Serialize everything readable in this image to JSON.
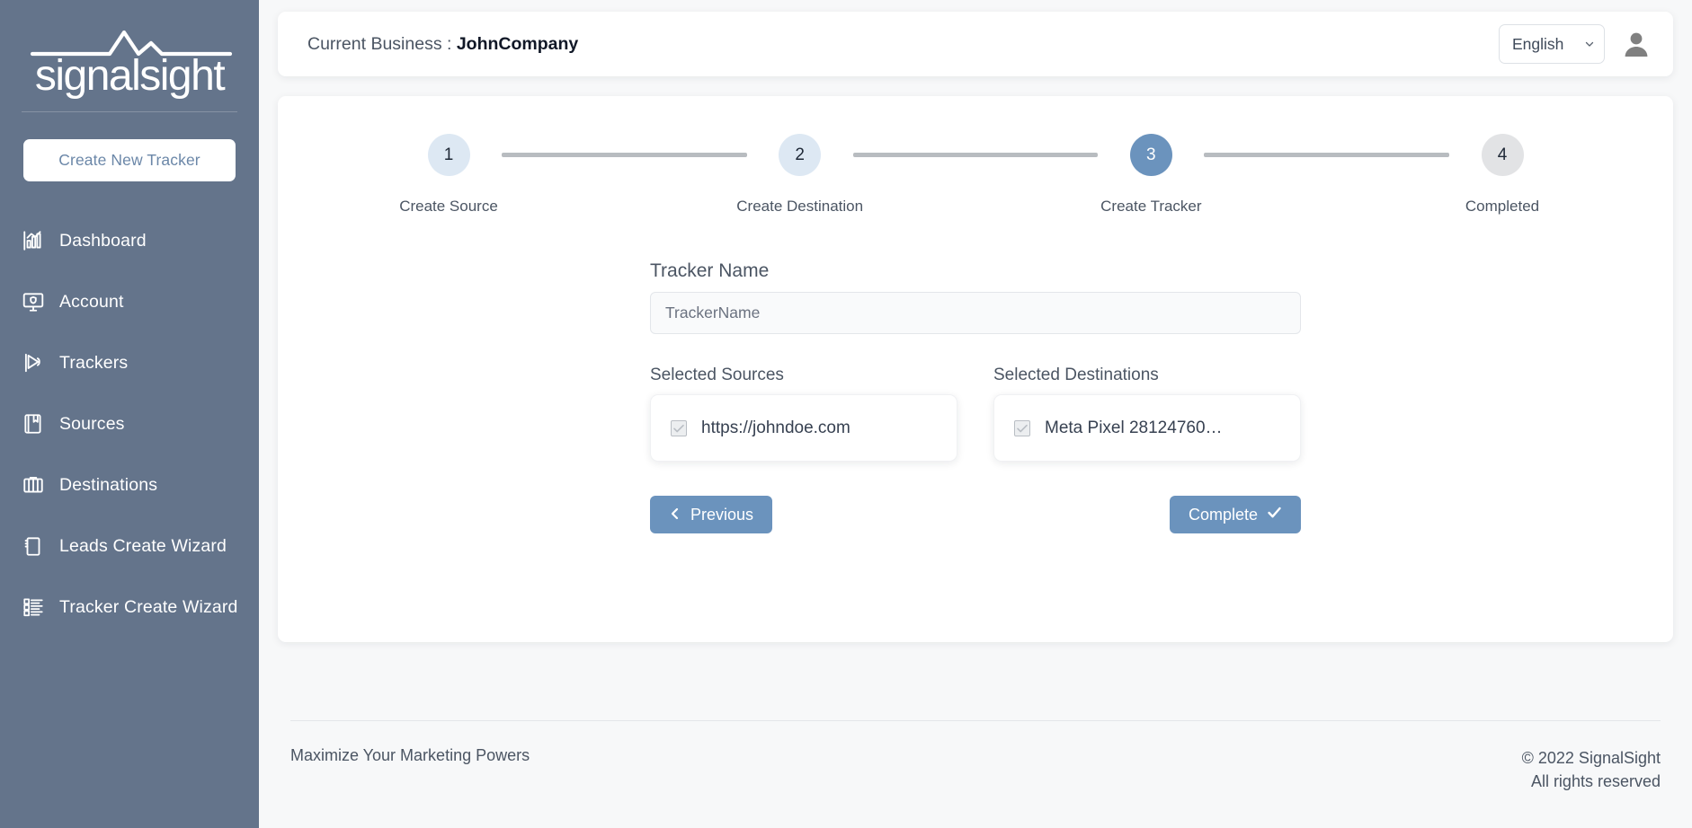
{
  "sidebar": {
    "logo_text": "signalsight",
    "create_button": "Create New Tracker",
    "items": [
      {
        "label": "Dashboard",
        "icon": "bar-chart-icon"
      },
      {
        "label": "Account",
        "icon": "monitor-shield-icon"
      },
      {
        "label": "Trackers",
        "icon": "flag-play-icon"
      },
      {
        "label": "Sources",
        "icon": "book-icon"
      },
      {
        "label": "Destinations",
        "icon": "briefcase-icon"
      },
      {
        "label": "Leads Create Wizard",
        "icon": "books-icon"
      },
      {
        "label": "Tracker Create Wizard",
        "icon": "checklist-icon"
      }
    ]
  },
  "header": {
    "business_prefix": "Current Business :",
    "business_name": "JohnCompany",
    "language_value": "English",
    "language_options": [
      "English"
    ],
    "avatar_icon": "user-avatar-icon"
  },
  "wizard": {
    "steps": [
      {
        "number": "1",
        "label": "Create Source",
        "state": "pending"
      },
      {
        "number": "2",
        "label": "Create Destination",
        "state": "pending"
      },
      {
        "number": "3",
        "label": "Create Tracker",
        "state": "active"
      },
      {
        "number": "4",
        "label": "Completed",
        "state": "inactive"
      }
    ],
    "tracker_name_label": "Tracker Name",
    "tracker_name_value": "",
    "tracker_name_placeholder": "TrackerName",
    "sources": {
      "label": "Selected Sources",
      "items": [
        {
          "text": "https://johndoe.com",
          "checked": true,
          "disabled": true
        }
      ]
    },
    "destinations": {
      "label": "Selected Destinations",
      "items": [
        {
          "text": "Meta Pixel 28124760…",
          "checked": true,
          "disabled": true
        }
      ]
    },
    "previous_button": "Previous",
    "complete_button": "Complete"
  },
  "footer": {
    "tagline": "Maximize Your Marketing Powers",
    "copyright": "© 2022 SignalSight",
    "rights": "All rights reserved"
  },
  "colors": {
    "sidebar": "#64748b",
    "accent": "#6b93bd",
    "step_pending": "#dde8f3",
    "step_inactive": "#e2e3e5",
    "page_bg": "#f7f8f9"
  }
}
